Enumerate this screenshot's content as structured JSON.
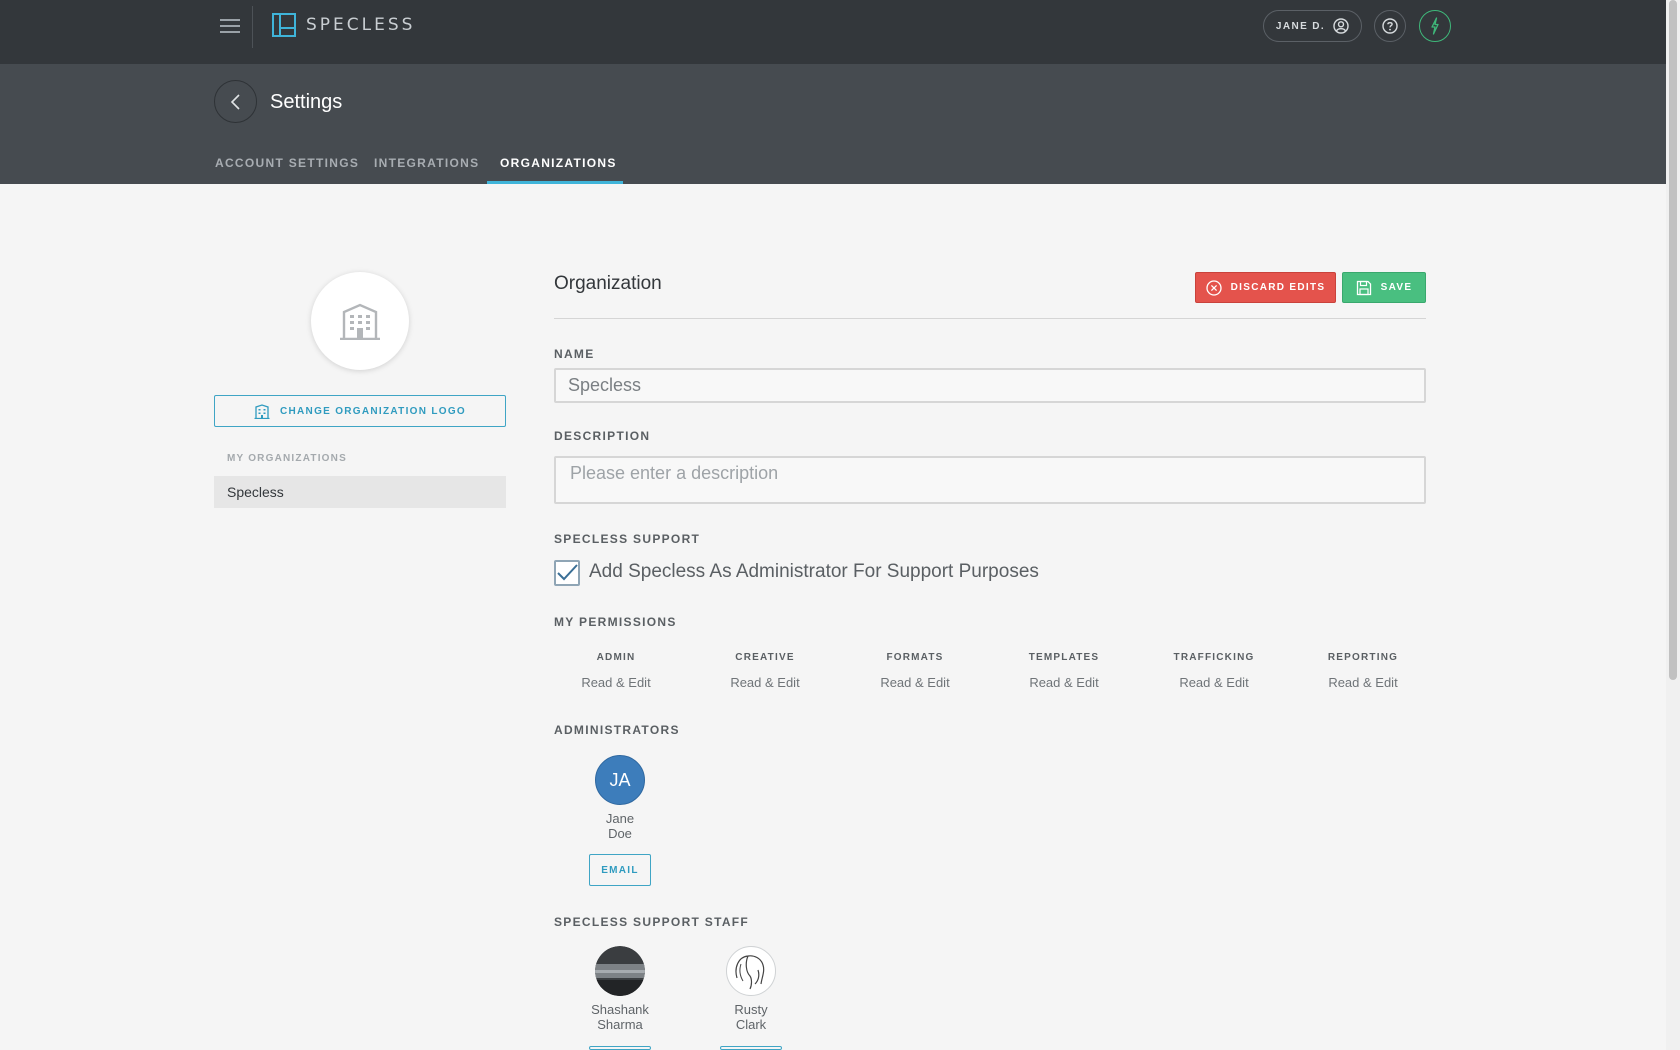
{
  "app": {
    "logo_text": "SPECLESS",
    "user_label": "JANE D."
  },
  "header": {
    "title": "Settings",
    "tabs": [
      {
        "label": "ACCOUNT SETTINGS"
      },
      {
        "label": "INTEGRATIONS"
      },
      {
        "label": "ORGANIZATIONS",
        "active": true
      }
    ]
  },
  "sidebar": {
    "change_logo_label": "CHANGE ORGANIZATION LOGO",
    "my_orgs_label": "MY ORGANIZATIONS",
    "orgs": [
      {
        "name": "Specless"
      }
    ]
  },
  "main": {
    "title": "Organization",
    "discard_label": "DISCARD EDITS",
    "save_label": "SAVE",
    "name_label": "NAME",
    "name_value": "Specless",
    "description_label": "DESCRIPTION",
    "description_placeholder": "Please enter a description",
    "support_label": "SPECLESS SUPPORT",
    "support_checkbox_label": "Add Specless As Administrator For Support Purposes",
    "support_checked": true,
    "permissions_label": "MY PERMISSIONS",
    "permissions": [
      {
        "name": "ADMIN",
        "value": "Read & Edit"
      },
      {
        "name": "CREATIVE",
        "value": "Read & Edit"
      },
      {
        "name": "FORMATS",
        "value": "Read & Edit"
      },
      {
        "name": "TEMPLATES",
        "value": "Read & Edit"
      },
      {
        "name": "TRAFFICKING",
        "value": "Read & Edit"
      },
      {
        "name": "REPORTING",
        "value": "Read & Edit"
      }
    ],
    "administrators_label": "ADMINISTRATORS",
    "administrators": [
      {
        "initials": "JA",
        "first": "Jane",
        "last": "Doe",
        "email_label": "EMAIL"
      }
    ],
    "support_staff_label": "SPECLESS SUPPORT STAFF",
    "support_staff": [
      {
        "first": "Shashank",
        "last": "Sharma"
      },
      {
        "first": "Rusty",
        "last": "Clark"
      }
    ]
  },
  "colors": {
    "topbar": "#33373b",
    "header": "#464b50",
    "accent": "#3fb4d9",
    "discard": "#e4534c",
    "save": "#49bf80",
    "avatar_blue": "#3d7dbb"
  }
}
